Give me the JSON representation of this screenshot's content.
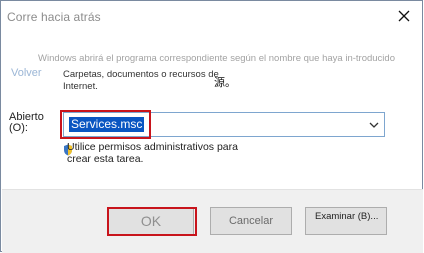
{
  "dialog": {
    "title": "Corre hacia atrás",
    "description_ghost": "Windows abrirá el programa correspondiente según el nombre que haya in-troducido",
    "icon_ghost_text": "Volver",
    "description": "Carpetas, documentos o recursos de Internet.",
    "small_char": "源。",
    "open_label": "Abierto (O):",
    "combo_value": "Services.msc",
    "admin_text": "Utilice permisos administrativos para crear esta tarea.",
    "buttons": {
      "ok": "OK",
      "cancel": "Cancelar",
      "browse": "Examinar (B)..."
    }
  },
  "icons": {
    "close": "close-icon",
    "dropdown": "chevron-down-icon",
    "admin": "shield-icon"
  },
  "colors": {
    "highlight": "#c8141c",
    "selection": "#0a56c2"
  }
}
